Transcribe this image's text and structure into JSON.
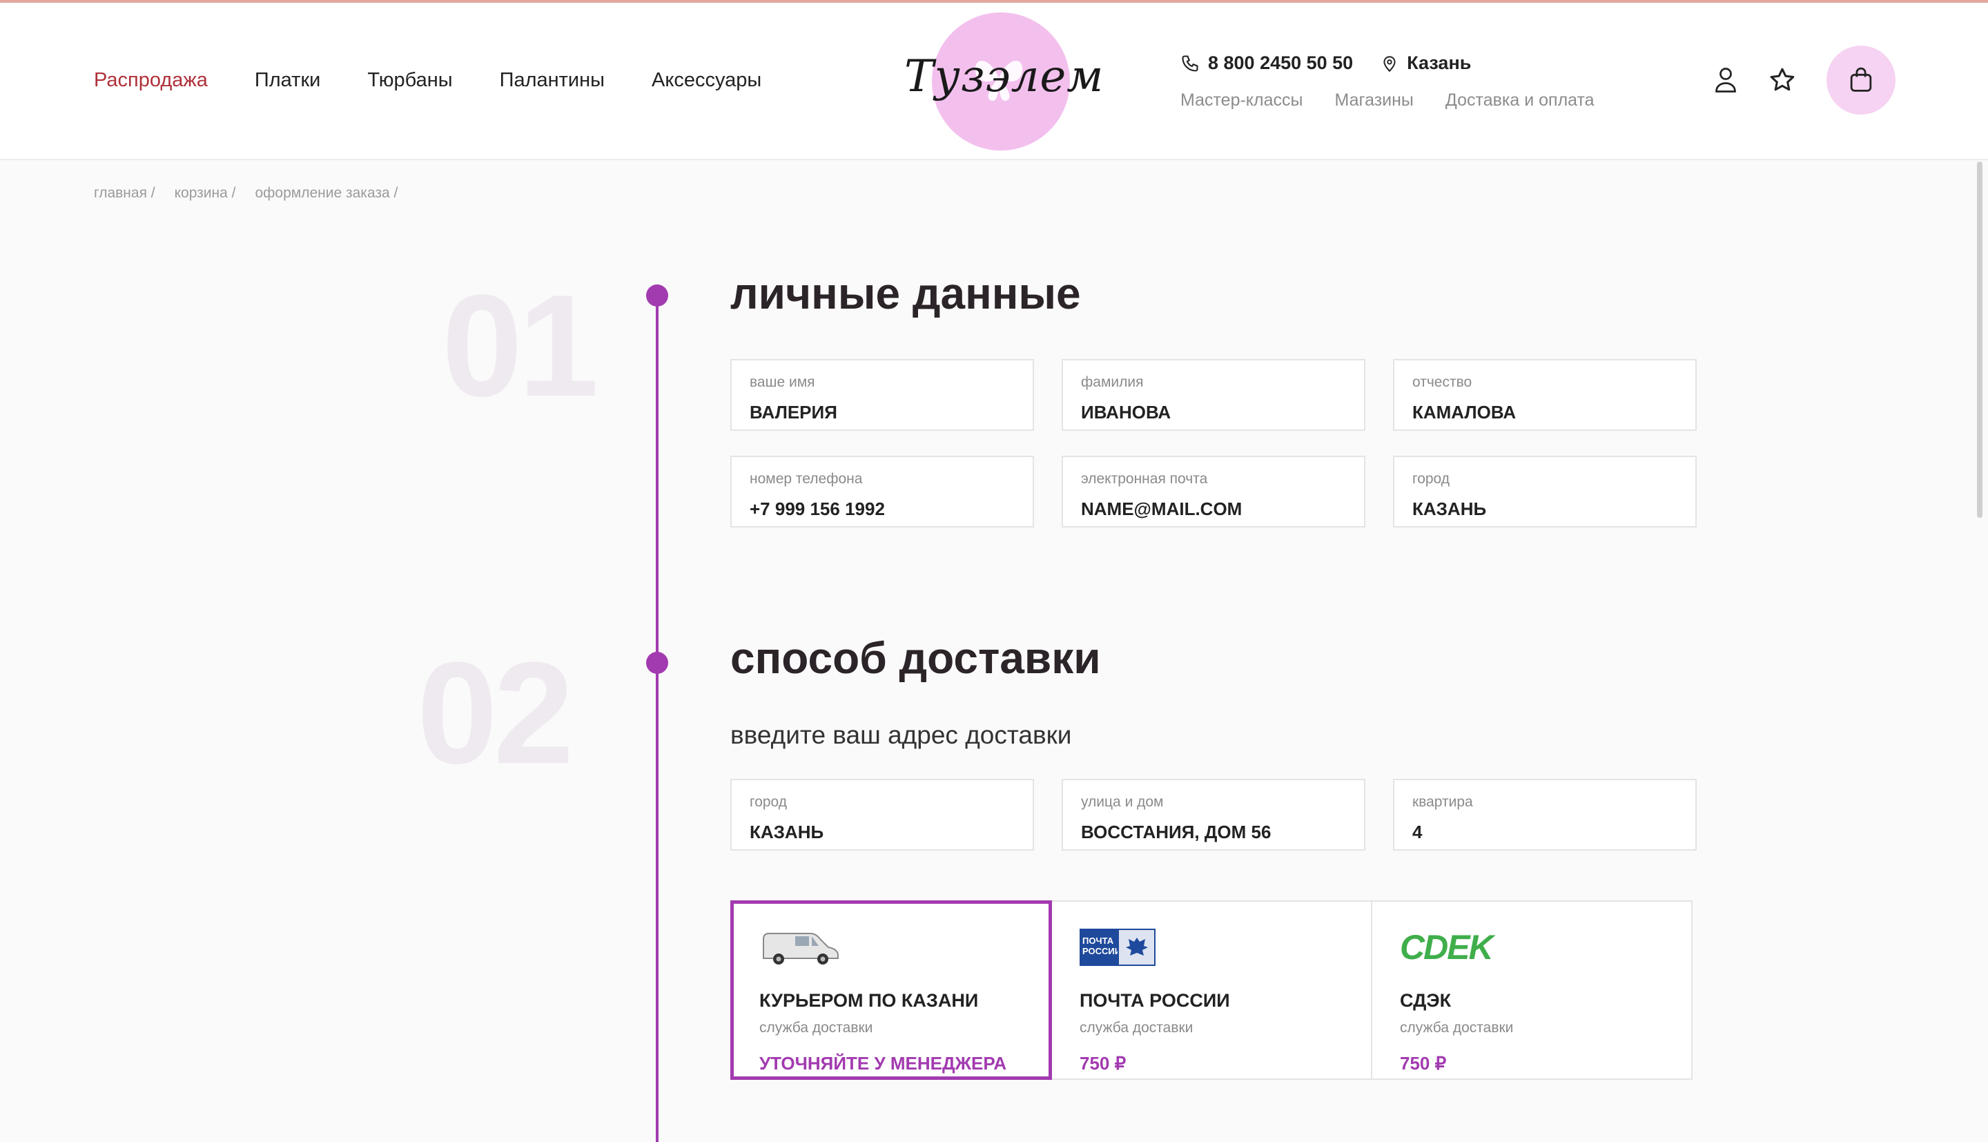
{
  "nav": {
    "items": [
      "Распродажа",
      "Платки",
      "Тюрбаны",
      "Палантины",
      "Аксессуары"
    ]
  },
  "logo": {
    "text": "Тузэлем"
  },
  "contacts": {
    "phone": "8 800 2450 50 50",
    "city": "Казань",
    "links": [
      "Мастер-классы",
      "Магазины",
      "Доставка и оплата"
    ]
  },
  "header_icons": [
    "user-icon",
    "star-icon",
    "shopping-bag-icon"
  ],
  "breadcrumb": [
    "главная /",
    "корзина /",
    "оформление заказа /"
  ],
  "section1": {
    "number": "01",
    "title": "личные данные",
    "fields": [
      {
        "label": "ваше имя",
        "value": "ВАЛЕРИЯ"
      },
      {
        "label": "фамилия",
        "value": "ИВАНОВА"
      },
      {
        "label": "отчество",
        "value": "КАМАЛОВА"
      },
      {
        "label": "номер телефона",
        "value": "+7 999 156 1992"
      },
      {
        "label": "электронная почта",
        "value": "NAME@MAIL.COM"
      },
      {
        "label": "город",
        "value": "КАЗАНЬ"
      }
    ]
  },
  "section2": {
    "number": "02",
    "title": "способ доставки",
    "subtitle": "введите ваш адрес доставки",
    "fields": [
      {
        "label": "город",
        "value": "КАЗАНЬ"
      },
      {
        "label": "улица и дом",
        "value": "ВОССТАНИЯ, ДОМ 56"
      },
      {
        "label": "квартира",
        "value": "4"
      }
    ],
    "options": [
      {
        "name": "КУРЬЕРОМ ПО КАЗАНИ",
        "service": "служба доставки",
        "price": "УТОЧНЯЙТЕ У МЕНЕДЖЕРА",
        "selected": true,
        "logo": "van-icon"
      },
      {
        "name": "ПОЧТА РОССИИ",
        "service": "служба доставки",
        "price": "750 ₽",
        "selected": false,
        "logo": "pochta-logo",
        "logo_text": "ПОЧТА РОССИИ"
      },
      {
        "name": "СДЭК",
        "service": "служба доставки",
        "price": "750 ₽",
        "selected": false,
        "logo": "cdek-logo",
        "logo_text": "CDEK"
      }
    ]
  },
  "colors": {
    "accent": "#a23ab0",
    "sale": "#b0303a",
    "logo_circle": "#f3c0ee",
    "cart_circle": "#f6d3f2",
    "cdek_green": "#3fae4b",
    "pochta_blue": "#1f4a9c"
  }
}
